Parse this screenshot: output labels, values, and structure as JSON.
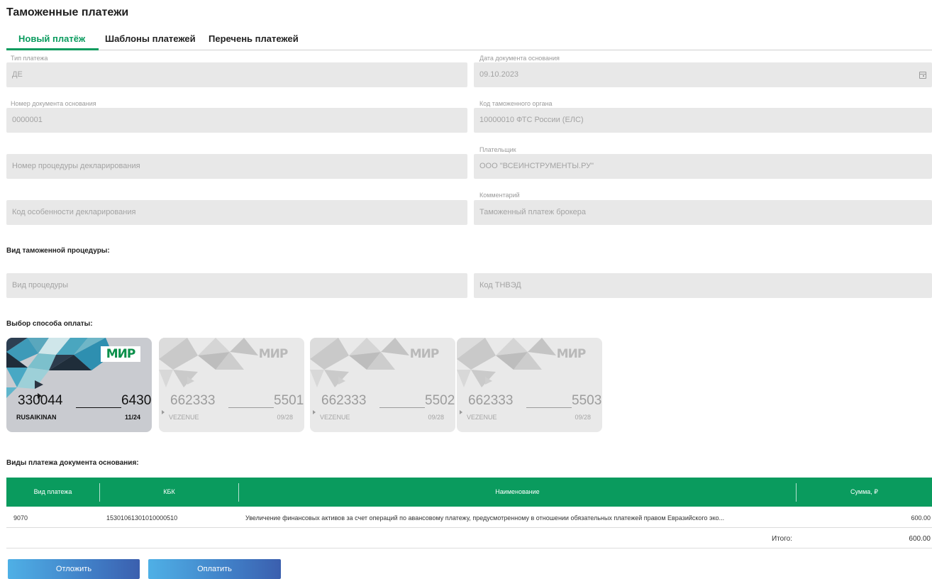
{
  "page": {
    "title": "Таможенные платежи"
  },
  "tabs": [
    {
      "label": "Новый платёж",
      "active": true
    },
    {
      "label": "Шаблоны платежей",
      "active": false
    },
    {
      "label": "Перечень платежей",
      "active": false
    }
  ],
  "form": {
    "payment_type": {
      "label": "Тип платежа",
      "value": "ДЕ"
    },
    "doc_date": {
      "label": "Дата документа основания",
      "value": "09.10.2023"
    },
    "doc_number": {
      "label": "Номер документа основания",
      "value": "0000001"
    },
    "customs_code": {
      "label": "Код таможенного органа",
      "value": "10000010 ФТС России (ЕЛС)"
    },
    "procedure_number": {
      "placeholder": "Номер процедуры декларирования"
    },
    "payer": {
      "label": "Плательщик",
      "value": "ООО \"ВСЕИНСТРУМЕНТЫ.РУ\""
    },
    "feature_code": {
      "placeholder": "Код особенности декларирования"
    },
    "comment": {
      "label": "Комментарий",
      "value": "Таможенный платеж брокера"
    }
  },
  "procedure_section": {
    "title": "Вид таможенной процедуры:",
    "kind_placeholder": "Вид процедуры",
    "tnved_placeholder": "Код ТНВЭД"
  },
  "payment_method": {
    "title": "Выбор способа оплаты:",
    "cards": [
      {
        "brand": "МИР",
        "number_start": "330044",
        "number_end": "6430",
        "holder": "RUSAIKINAN",
        "expiry": "11/24",
        "selected": true
      },
      {
        "brand": "МИР",
        "number_start": "662333",
        "number_end": "5501",
        "holder": "VEZENUE",
        "expiry": "09/28",
        "selected": false
      },
      {
        "brand": "МИР",
        "number_start": "662333",
        "number_end": "5502",
        "holder": "VEZENUE",
        "expiry": "09/28",
        "selected": false
      },
      {
        "brand": "МИР",
        "number_start": "662333",
        "number_end": "5503",
        "holder": "VEZENUE",
        "expiry": "09/28",
        "selected": false
      }
    ]
  },
  "payments_table": {
    "title": "Виды платежа документа основания:",
    "columns": [
      "Вид платежа",
      "КБК",
      "Наименование",
      "Сумма, ₽"
    ],
    "rows": [
      {
        "type": "9070",
        "kbk": "15301061301010000510",
        "name": "Увеличение финансовых активов за счет операций по авансовому платежу, предусмотренному в отношении обязательных платежей правом Евразийского эко...",
        "amount": "600.00"
      }
    ],
    "total_label": "Итого:",
    "total_value": "600.00"
  },
  "actions": {
    "postpone": "Отложить",
    "pay": "Оплатить"
  },
  "colors": {
    "accent": "#0a9b5e",
    "field_bg": "#e8e8e8",
    "button_from": "#4fb0e6",
    "button_to": "#3b5fae",
    "mir_green": "#0a8f4a"
  }
}
